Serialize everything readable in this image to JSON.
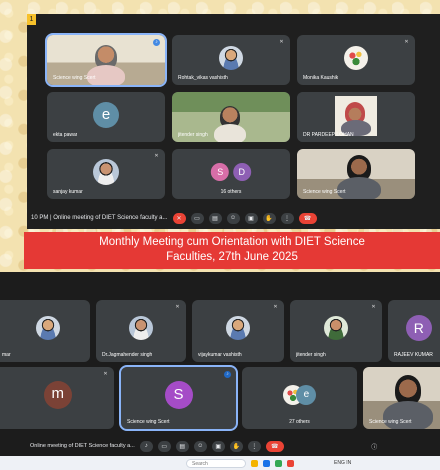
{
  "top_call": {
    "badge": "1",
    "participants": [
      {
        "name": "Science wing Scert",
        "kind": "video"
      },
      {
        "name": "Rohtak_vikas vashisth",
        "kind": "photo"
      },
      {
        "name": "Monika Kaushik",
        "kind": "flowers"
      },
      {
        "name": "ekta pawar",
        "kind": "letter",
        "letter": "e",
        "color": "#5f8ea6"
      },
      {
        "name": "jitender singh",
        "kind": "video"
      },
      {
        "name": "DR PARDEEP LOHAN",
        "kind": "video"
      },
      {
        "name": "sanjay kumar",
        "kind": "photo"
      },
      {
        "name": "16 others",
        "kind": "others",
        "letters": [
          "S",
          "D"
        ]
      },
      {
        "name": "Science wing Scert",
        "kind": "video"
      }
    ],
    "toolbar": {
      "time_meeting": "10 PM  |  Online meeting of DIET Science faculty a..."
    }
  },
  "banner": {
    "line1": "Monthly Meeting cum Orientation with DIET Science",
    "line2": "Faculties, 27th June 2025"
  },
  "bottom_call": {
    "participants": [
      {
        "name": "mar",
        "kind": "photo"
      },
      {
        "name": "Dr.Jagmahender singh",
        "kind": "photo"
      },
      {
        "name": "vijaykumar vashisth",
        "kind": "photo"
      },
      {
        "name": "jitender singh",
        "kind": "photo"
      },
      {
        "name": "RAJEEV KUMAR",
        "kind": "letter",
        "letter": "R",
        "color": "#8e5fb4"
      },
      {
        "name": "ekta pawar",
        "kind": "letter",
        "letter": "m",
        "color": "#7b4236"
      },
      {
        "name": "Science wing Scert",
        "kind": "letter",
        "letter": "S",
        "color": "#a54cc7"
      },
      {
        "name": "27 others",
        "kind": "others"
      },
      {
        "name": "Science wing Scert",
        "kind": "video"
      }
    ],
    "toolbar": {
      "meeting_title": "Online meeting of DIET Science faculty a..."
    }
  },
  "taskbar": {
    "search_placeholder": "Search",
    "tray_text": "ENG IN"
  },
  "colors": {
    "banner_red": "#e53935",
    "active_outline": "#8ab4f8",
    "end_call_red": "#ea4335"
  }
}
